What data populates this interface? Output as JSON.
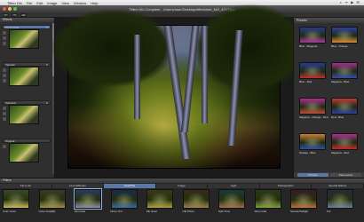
{
  "menubar": {
    "app": "Tiffen Dfx",
    "items": [
      "File",
      "Edit",
      "Image",
      "View",
      "Window",
      "Help"
    ],
    "status": "◐ ᯤ ▶ ☰"
  },
  "window": {
    "title": "Tiffen Dfx Complete - /Users/user/Desktop/tiffen/wmt_MG_4217.jpg",
    "traffic_colors": [
      "#ee5c54",
      "#f5c04a",
      "#5fc451"
    ]
  },
  "toolbar": {
    "buttons": [
      "↶",
      "↷",
      "⊞"
    ]
  },
  "left_panel": {
    "title": "Effects",
    "items": [
      {
        "label": "Cross Grad",
        "selected": true
      },
      {
        "label": "Vignette",
        "selected": false
      },
      {
        "label": "Selective",
        "selected": false
      },
      {
        "label": "Original",
        "selected": false
      }
    ]
  },
  "right_panel": {
    "title": "Presets",
    "presets": [
      {
        "label": "Blue - Magenta",
        "colors": [
          "#2a3a88",
          "#b03a9a"
        ]
      },
      {
        "label": "Blue - Orange",
        "colors": [
          "#3040a0",
          "#e08a3a"
        ]
      },
      {
        "label": "Blue - Red",
        "colors": [
          "#2a3a90",
          "#c03030"
        ]
      },
      {
        "label": "Magenta - Blue",
        "colors": [
          "#a03090",
          "#3a4aa8"
        ]
      },
      {
        "label": "Magenta - Orange - Red",
        "colors": [
          "#b03090",
          "#c05030"
        ]
      },
      {
        "label": "Red - Blue",
        "colors": [
          "#c03a3a",
          "#3040a0"
        ]
      },
      {
        "label": "Orange - Blue",
        "colors": [
          "#d08030",
          "#3050a0"
        ]
      },
      {
        "label": "Magenta - Red",
        "colors": [
          "#b03090",
          "#c02a2a"
        ]
      }
    ],
    "tabs": [
      "Presets",
      "Parameters"
    ]
  },
  "bottom": {
    "title": "Filters",
    "categories": [
      "Film Lab",
      "Lens Diffusion",
      "Grad/Tint",
      "Image",
      "Light",
      "Photographic",
      "Special Effects"
    ],
    "selected_category": "Grad/Tint",
    "filters": [
      {
        "label": "Color Grad",
        "colors": [
          "#3a4a2a",
          "#c8b860"
        ]
      },
      {
        "label": "Color-Grad(B)",
        "colors": [
          "#3a3a2a",
          "#a09050"
        ]
      },
      {
        "label": "Dbl Grad",
        "colors": [
          "#2a3a5a",
          "#9090a0"
        ]
      },
      {
        "label": "Mono Tint",
        "colors": [
          "#1a2a4a",
          "#3a6aa0"
        ]
      },
      {
        "label": "Mk Grad",
        "colors": [
          "#3a3a1a",
          "#b0a040"
        ]
      },
      {
        "label": "Old Photo",
        "colors": [
          "#3a2a1a",
          "#a08050"
        ]
      },
      {
        "label": "Split Tone",
        "colors": [
          "#1a3a3a",
          "#a07050"
        ]
      },
      {
        "label": "Strip Grad",
        "colors": [
          "#2a3a1a",
          "#80a040"
        ]
      },
      {
        "label": "Sunset/Twilight",
        "colors": [
          "#3a1a2a",
          "#c07040"
        ]
      },
      {
        "label": "Tint",
        "colors": [
          "#2a2a3a",
          "#7080a0"
        ]
      }
    ]
  }
}
